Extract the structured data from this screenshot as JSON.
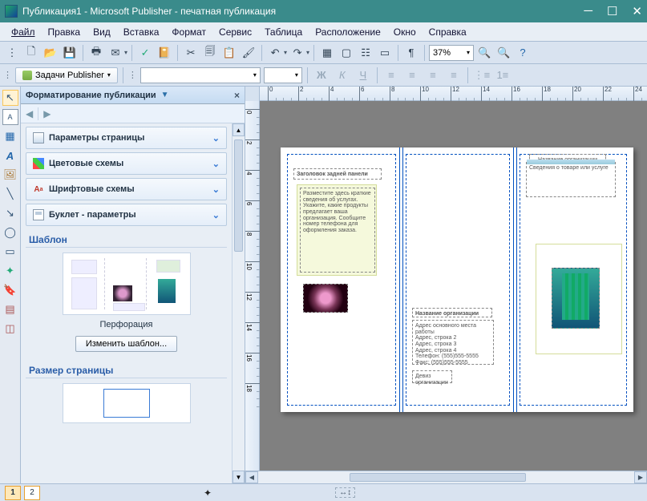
{
  "titlebar": {
    "text": "Публикация1 - Microsoft Publisher - печатная публикация"
  },
  "menu": [
    "Файл",
    "Правка",
    "Вид",
    "Вставка",
    "Формат",
    "Сервис",
    "Таблица",
    "Расположение",
    "Окно",
    "Справка"
  ],
  "zoom": "37%",
  "toolbar2": {
    "tasks_label": "Задачи Publisher"
  },
  "taskpane": {
    "header": "Форматирование публикации",
    "accordion": [
      {
        "label": "Параметры страницы"
      },
      {
        "label": "Цветовые схемы"
      },
      {
        "label": "Шрифтовые схемы"
      },
      {
        "label": "Буклет - параметры"
      }
    ],
    "template_title": "Шаблон",
    "template_caption": "Перфорация",
    "change_btn": "Изменить шаблон...",
    "pagesize_title": "Размер страницы"
  },
  "ruler_h": [
    "0",
    "2",
    "4",
    "6",
    "8",
    "10",
    "12",
    "14",
    "16",
    "18",
    "20",
    "22",
    "24"
  ],
  "ruler_v": [
    "0",
    "2",
    "4",
    "6",
    "8",
    "10",
    "12",
    "14",
    "16",
    "18"
  ],
  "doc": {
    "panel1_head": "Заголовок задней панели",
    "panel1_body": "Разместите здесь краткие сведения об услугах. Укажите, какие продукты предлагает ваша организация. Сообщите номер телефона для оформления заказа.",
    "panel2_head": "Название организации",
    "panel2_body": "Адрес основного места работы\nАдрес, строка 2\nАдрес, строка 3\nАдрес, строка 4\nТелефон: (555)555-5555\nФакс: (555)555-5555",
    "panel2_slogan": "Девиз организации",
    "panel3_caption": "Название организации",
    "panel3_head": "Сведения о товаре или услуге"
  },
  "pages": [
    "1",
    "2"
  ]
}
